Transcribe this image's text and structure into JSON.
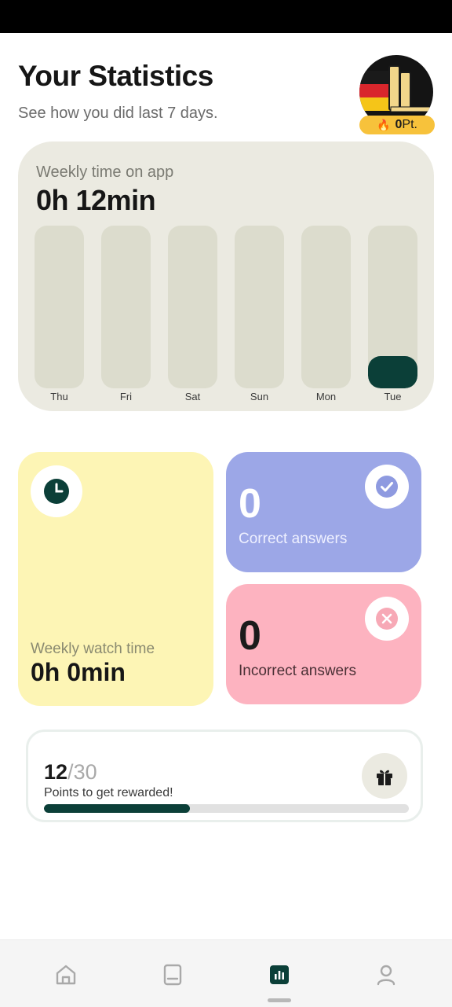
{
  "header": {
    "title": "Your Statistics",
    "subtitle": "See how you did last 7 days.",
    "points_value": "0",
    "points_unit": "Pt."
  },
  "weekly_app_time": {
    "label": "Weekly time on app",
    "value": "0h 12min"
  },
  "chart_data": {
    "type": "bar",
    "categories": [
      "Thu",
      "Fri",
      "Sat",
      "Sun",
      "Mon",
      "Tue"
    ],
    "values": [
      0,
      0,
      0,
      0,
      0,
      12
    ],
    "ylabel": "",
    "xlabel": "",
    "title": ""
  },
  "watch_time": {
    "label": "Weekly watch time",
    "value": "0h 0min"
  },
  "correct": {
    "count": "0",
    "label": "Correct answers"
  },
  "incorrect": {
    "count": "0",
    "label": "Incorrect answers"
  },
  "reward": {
    "current": "12",
    "separator": "/",
    "total": "30",
    "label": "Points to get rewarded!",
    "progress": 0.4
  },
  "nav": {
    "items": [
      "home-icon",
      "book-icon",
      "statistics-icon",
      "profile-icon"
    ],
    "active": "statistics-icon"
  },
  "colors": {
    "accent": "#0b3f38",
    "correct_card": "#9ca7e7",
    "incorrect_card": "#fdb3c0",
    "watch_card": "#fdf5b5",
    "points_pill": "#f7c23b"
  }
}
